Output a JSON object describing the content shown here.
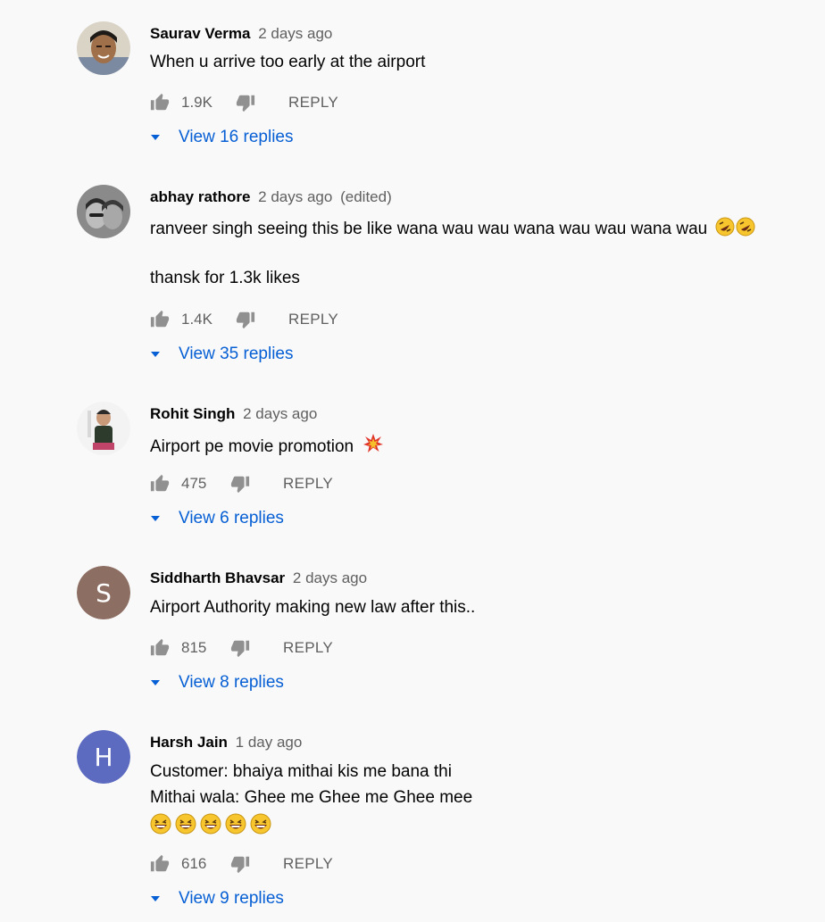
{
  "comments": [
    {
      "author": "Saurav Verma",
      "time": "2 days ago",
      "edited": "",
      "lines": [
        "When u arrive too early at the airport"
      ],
      "likes": "1.9K",
      "reply_label": "REPLY",
      "view_replies": "View 16 replies",
      "avatar": {
        "type": "photo",
        "icon": "user-photo-avatar"
      }
    },
    {
      "author": "abhay rathore",
      "time": "2 days ago",
      "edited": "(edited)",
      "lines": [
        "ranveer singh seeing this be like wana wau wau wana wau wau wana wau",
        "",
        "thansk for 1.3k likes"
      ],
      "likes": "1.4K",
      "reply_label": "REPLY",
      "view_replies": "View 35 replies",
      "avatar": {
        "type": "photo",
        "icon": "user-photo-avatar"
      }
    },
    {
      "author": "Rohit Singh",
      "time": "2 days ago",
      "edited": "",
      "lines": [
        "Airport pe movie promotion"
      ],
      "likes": "475",
      "reply_label": "REPLY",
      "view_replies": "View 6 replies",
      "avatar": {
        "type": "photo",
        "icon": "user-photo-avatar"
      }
    },
    {
      "author": "Siddharth Bhavsar",
      "time": "2 days ago",
      "edited": "",
      "lines": [
        "Airport Authority making new law after this.."
      ],
      "likes": "815",
      "reply_label": "REPLY",
      "view_replies": "View 8 replies",
      "avatar": {
        "type": "letter",
        "letter": "S",
        "color": "#8d6e63"
      }
    },
    {
      "author": "Harsh Jain",
      "time": "1 day ago",
      "edited": "",
      "lines": [
        "Customer: bhaiya mithai kis me bana thi",
        "Mithai wala: Ghee me Ghee me Ghee mee"
      ],
      "likes": "616",
      "reply_label": "REPLY",
      "view_replies": "View 9 replies",
      "avatar": {
        "type": "letter",
        "letter": "H",
        "color": "#5c6bc0"
      }
    }
  ],
  "colors": {
    "background": "#f9f9f9",
    "link": "#065fd4",
    "meta_text": "#606060",
    "primary_text": "#030303"
  },
  "icons": {
    "like": "thumb-up-icon",
    "dislike": "thumb-down-icon",
    "caret": "caret-down-icon",
    "rofl_emoji": "rolling-on-floor-laughing-emoji",
    "collision_emoji": "collision-emoji",
    "laughing_emoji": "grinning-squinting-emoji"
  }
}
